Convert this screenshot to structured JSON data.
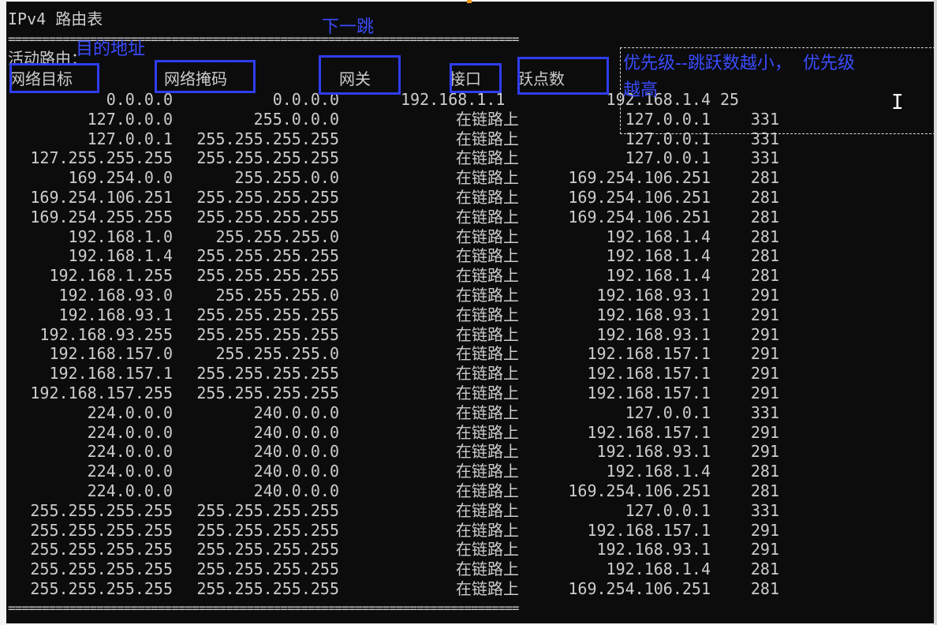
{
  "title": "IPv4 路由表",
  "separator": "===========================================================================",
  "section_label": "活动路由：",
  "headers": {
    "destination": "网络目标",
    "netmask": "网络掩码",
    "gateway": "网关",
    "interface": "接口",
    "metric": "跃点数"
  },
  "annotations": {
    "destination_note": "目的地址",
    "gateway_note": "下一跳",
    "priority_line1": "优先级--跳跃数越小，  优先级",
    "priority_line2": "越高"
  },
  "routes": [
    {
      "dest": "0.0.0.0",
      "mask": "0.0.0.0",
      "gateway": "192.168.1.1",
      "iface": "192.168.1.4",
      "metric": "25"
    },
    {
      "dest": "127.0.0.0",
      "mask": "255.0.0.0",
      "gateway": "在链路上",
      "iface": "127.0.0.1",
      "metric": "331"
    },
    {
      "dest": "127.0.0.1",
      "mask": "255.255.255.255",
      "gateway": "在链路上",
      "iface": "127.0.0.1",
      "metric": "331"
    },
    {
      "dest": "127.255.255.255",
      "mask": "255.255.255.255",
      "gateway": "在链路上",
      "iface": "127.0.0.1",
      "metric": "331"
    },
    {
      "dest": "169.254.0.0",
      "mask": "255.255.0.0",
      "gateway": "在链路上",
      "iface": "169.254.106.251",
      "metric": "281"
    },
    {
      "dest": "169.254.106.251",
      "mask": "255.255.255.255",
      "gateway": "在链路上",
      "iface": "169.254.106.251",
      "metric": "281"
    },
    {
      "dest": "169.254.255.255",
      "mask": "255.255.255.255",
      "gateway": "在链路上",
      "iface": "169.254.106.251",
      "metric": "281"
    },
    {
      "dest": "192.168.1.0",
      "mask": "255.255.255.0",
      "gateway": "在链路上",
      "iface": "192.168.1.4",
      "metric": "281"
    },
    {
      "dest": "192.168.1.4",
      "mask": "255.255.255.255",
      "gateway": "在链路上",
      "iface": "192.168.1.4",
      "metric": "281"
    },
    {
      "dest": "192.168.1.255",
      "mask": "255.255.255.255",
      "gateway": "在链路上",
      "iface": "192.168.1.4",
      "metric": "281"
    },
    {
      "dest": "192.168.93.0",
      "mask": "255.255.255.0",
      "gateway": "在链路上",
      "iface": "192.168.93.1",
      "metric": "291"
    },
    {
      "dest": "192.168.93.1",
      "mask": "255.255.255.255",
      "gateway": "在链路上",
      "iface": "192.168.93.1",
      "metric": "291"
    },
    {
      "dest": "192.168.93.255",
      "mask": "255.255.255.255",
      "gateway": "在链路上",
      "iface": "192.168.93.1",
      "metric": "291"
    },
    {
      "dest": "192.168.157.0",
      "mask": "255.255.255.0",
      "gateway": "在链路上",
      "iface": "192.168.157.1",
      "metric": "291"
    },
    {
      "dest": "192.168.157.1",
      "mask": "255.255.255.255",
      "gateway": "在链路上",
      "iface": "192.168.157.1",
      "metric": "291"
    },
    {
      "dest": "192.168.157.255",
      "mask": "255.255.255.255",
      "gateway": "在链路上",
      "iface": "192.168.157.1",
      "metric": "291"
    },
    {
      "dest": "224.0.0.0",
      "mask": "240.0.0.0",
      "gateway": "在链路上",
      "iface": "127.0.0.1",
      "metric": "331"
    },
    {
      "dest": "224.0.0.0",
      "mask": "240.0.0.0",
      "gateway": "在链路上",
      "iface": "192.168.157.1",
      "metric": "291"
    },
    {
      "dest": "224.0.0.0",
      "mask": "240.0.0.0",
      "gateway": "在链路上",
      "iface": "192.168.93.1",
      "metric": "291"
    },
    {
      "dest": "224.0.0.0",
      "mask": "240.0.0.0",
      "gateway": "在链路上",
      "iface": "192.168.1.4",
      "metric": "281"
    },
    {
      "dest": "224.0.0.0",
      "mask": "240.0.0.0",
      "gateway": "在链路上",
      "iface": "169.254.106.251",
      "metric": "281"
    },
    {
      "dest": "255.255.255.255",
      "mask": "255.255.255.255",
      "gateway": "在链路上",
      "iface": "127.0.0.1",
      "metric": "331"
    },
    {
      "dest": "255.255.255.255",
      "mask": "255.255.255.255",
      "gateway": "在链路上",
      "iface": "192.168.157.1",
      "metric": "291"
    },
    {
      "dest": "255.255.255.255",
      "mask": "255.255.255.255",
      "gateway": "在链路上",
      "iface": "192.168.93.1",
      "metric": "291"
    },
    {
      "dest": "255.255.255.255",
      "mask": "255.255.255.255",
      "gateway": "在链路上",
      "iface": "192.168.1.4",
      "metric": "281"
    },
    {
      "dest": "255.255.255.255",
      "mask": "255.255.255.255",
      "gateway": "在链路上",
      "iface": "169.254.106.251",
      "metric": "281"
    }
  ],
  "colors": {
    "console_bg": "#0c0c0c",
    "console_text": "#cccccc",
    "annotation": "#3a4bff"
  }
}
